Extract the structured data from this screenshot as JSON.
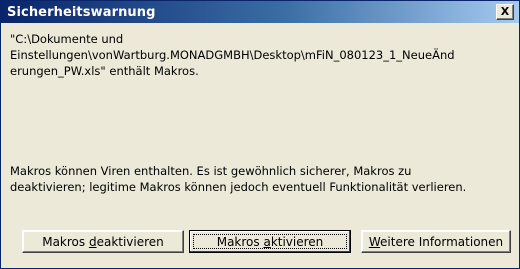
{
  "window": {
    "title": "Sicherheitswarnung",
    "close_glyph": "X"
  },
  "message": {
    "paragraph1": "\"C:\\Dokumente und\nEinstellungen\\vonWartburg.MONADGMBH\\Desktop\\mFiN_080123_1_NeueÄnd\nerungen_PW.xls\" enthält Makros.",
    "paragraph2": "Makros können Viren enthalten. Es ist gewöhnlich sicherer, Makros zu\ndeaktivieren; legitime Makros können jedoch eventuell Funktionalität verlieren."
  },
  "buttons": {
    "deactivate": {
      "pre": "Makros ",
      "accel": "d",
      "post": "eaktivieren"
    },
    "activate": {
      "pre": "Makros ",
      "accel": "a",
      "post": "ktivieren"
    },
    "info": {
      "pre": "",
      "accel": "W",
      "post": "eitere Informationen"
    }
  }
}
